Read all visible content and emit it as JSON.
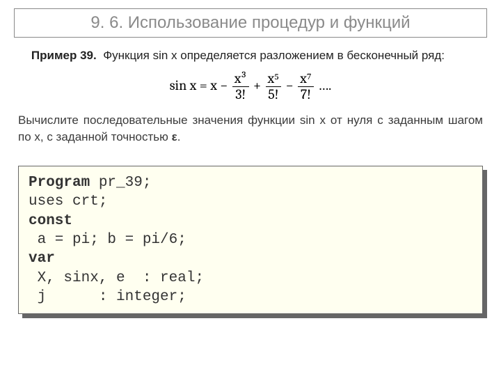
{
  "title": "9. 6. Использование процедур и функций",
  "example_label": "Пример 39.",
  "example_text_part1": "Функция sin x определяется разложением в бесконечный ряд:",
  "formula": {
    "lhs": "sin x",
    "terms": [
      {
        "sign": "",
        "num": "x",
        "den": ""
      },
      {
        "sign": "−",
        "num": "x³",
        "den": "3!"
      },
      {
        "sign": "+",
        "num": "x⁵",
        "den": "5!"
      },
      {
        "sign": "−",
        "num": "x⁷",
        "den": "7!"
      }
    ],
    "tail": "…."
  },
  "task_text": "Вычислите последовательные значения функции sin x от нуля с заданным шагом по x, с заданной точностью ",
  "epsilon": "ε",
  "task_tail": ".",
  "code": {
    "l1a": "Program",
    "l1b": " pr_39;",
    "l2": "uses crt;",
    "l3": "const",
    "l4": " a = pi; b = pi/6;",
    "l5": "var",
    "l6": " X, sinx, e  : real;",
    "l7": " j      : integer;"
  }
}
